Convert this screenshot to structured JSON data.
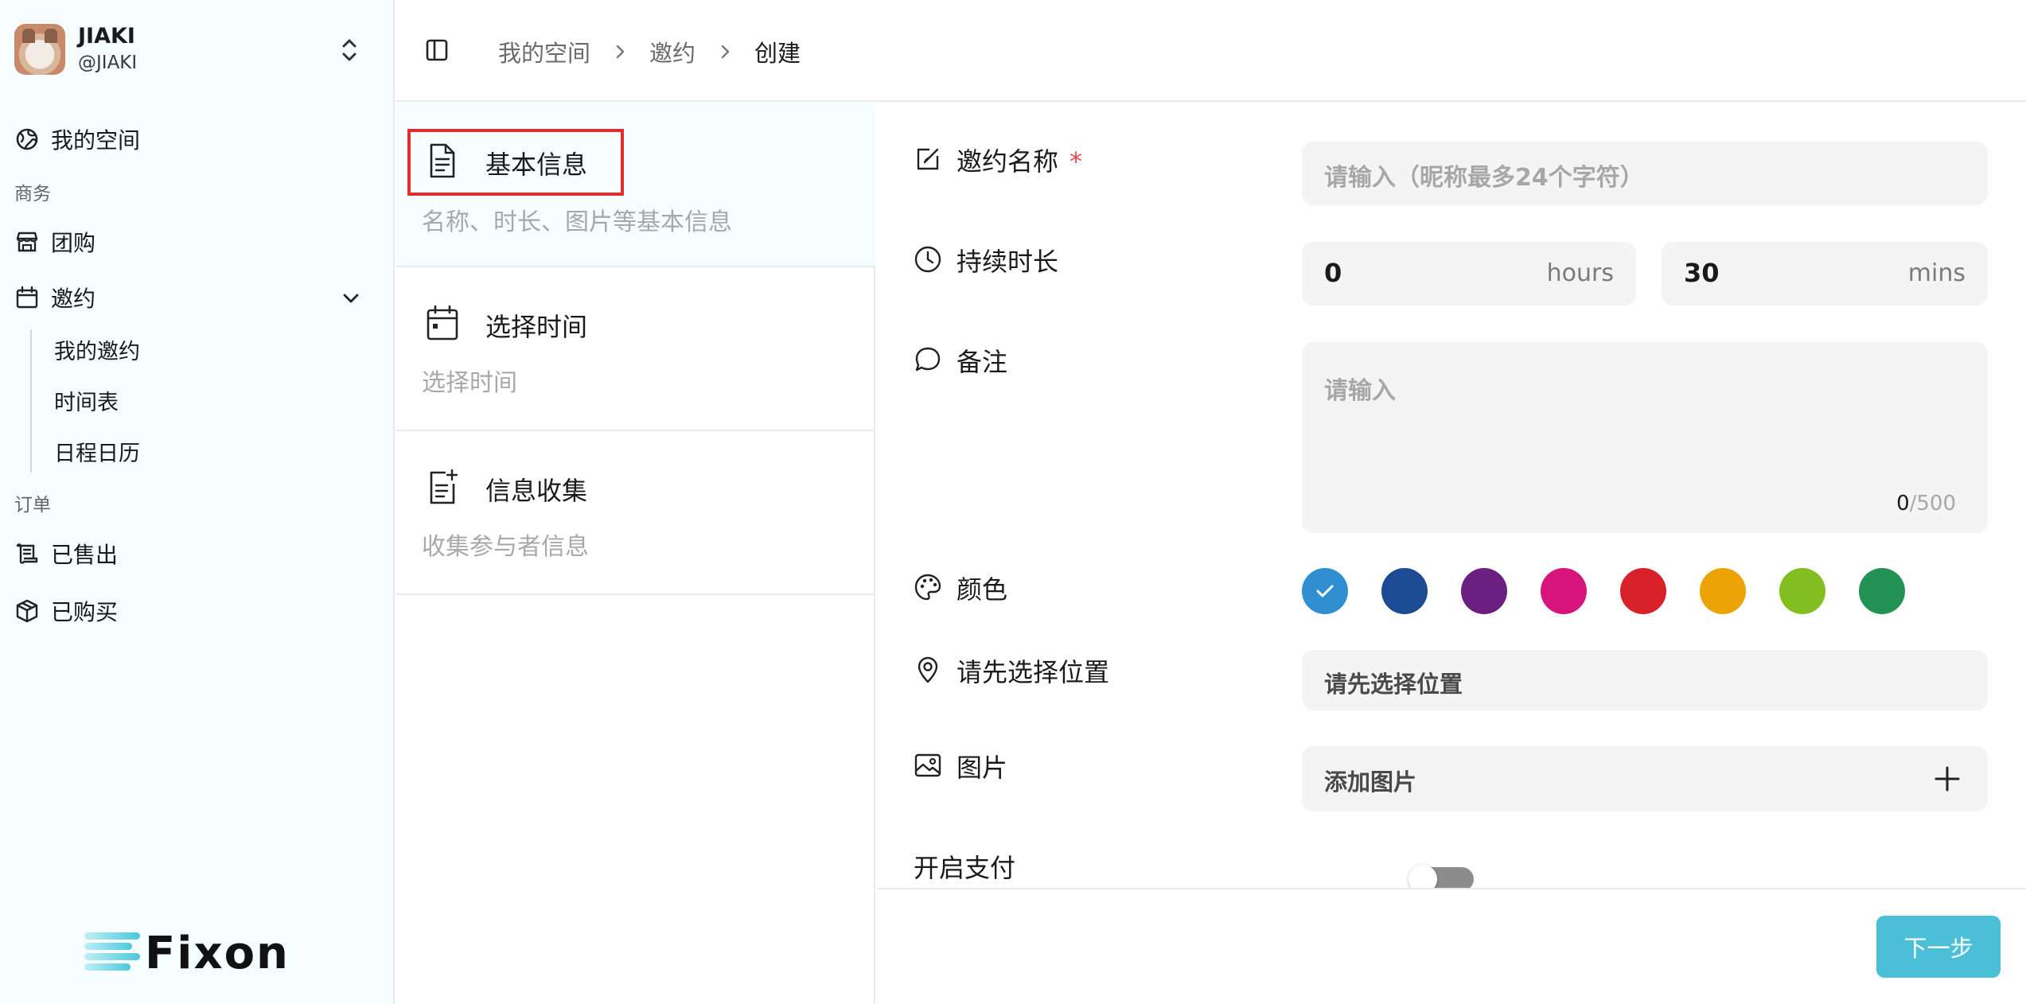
{
  "user": {
    "name": "JIAKI",
    "handle": "@JIAKI"
  },
  "sidebar": {
    "my_space": "我的空间",
    "section_business": "商务",
    "group_buy": "团购",
    "invite": "邀约",
    "invite_children": [
      "我的邀约",
      "时间表",
      "日程日历"
    ],
    "section_orders": "订单",
    "sold": "已售出",
    "bought": "已购买"
  },
  "logo": {
    "text": "Fixon"
  },
  "breadcrumb": [
    "我的空间",
    "邀约",
    "创建"
  ],
  "steps": [
    {
      "title": "基本信息",
      "desc": "名称、时长、图片等基本信息",
      "icon": "document-icon",
      "active": true
    },
    {
      "title": "选择时间",
      "desc": "选择时间",
      "icon": "calendar-icon",
      "active": false
    },
    {
      "title": "信息收集",
      "desc": "收集参与者信息",
      "icon": "document-add-icon",
      "active": false
    }
  ],
  "form": {
    "name_label": "邀约名称",
    "required_mark": "*",
    "name_placeholder": "请输入（昵称最多24个字符）",
    "duration_label": "持续时长",
    "hours_value": "0",
    "hours_unit": "hours",
    "mins_value": "30",
    "mins_unit": "mins",
    "note_label": "备注",
    "note_placeholder": "请输入",
    "note_count": "0",
    "note_max": "/500",
    "color_label": "颜色",
    "colors": [
      "#2f8fd1",
      "#1c4a93",
      "#6b1f80",
      "#d6147b",
      "#d62228",
      "#eba305",
      "#82be1f",
      "#249254"
    ],
    "selected_color_index": 0,
    "location_label": "请先选择位置",
    "location_value": "请先选择位置",
    "image_label": "图片",
    "image_value": "添加图片",
    "payment_label": "开启支付",
    "payment_enabled": false
  },
  "footer": {
    "next_label": "下一步"
  },
  "theme": {
    "accent": "#4bbfd8",
    "highlight": "#e02c2c",
    "required": "#e5484d"
  }
}
